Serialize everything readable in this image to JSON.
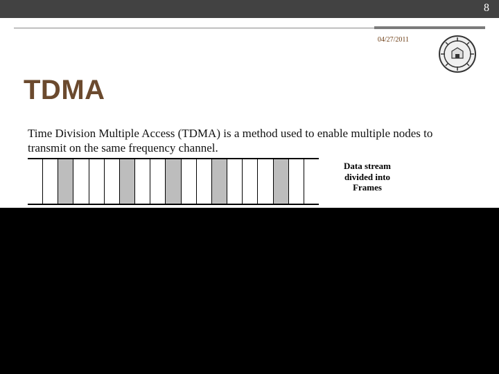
{
  "page_number": "8",
  "date": "04/27/2011",
  "title": "TDMA",
  "body": "Time Division Multiple Access (TDMA) is a method used to enable multiple nodes to transmit on the same frequency channel.",
  "diagram": {
    "label_line1": "Data stream",
    "label_line2": "divided into",
    "label_line3": "Frames",
    "slots": [
      false,
      false,
      true,
      false,
      false,
      false,
      true,
      false,
      false,
      true,
      false,
      false,
      true,
      false,
      false,
      false,
      true,
      false,
      false
    ]
  },
  "seal_icon_name": "university-seal-icon"
}
